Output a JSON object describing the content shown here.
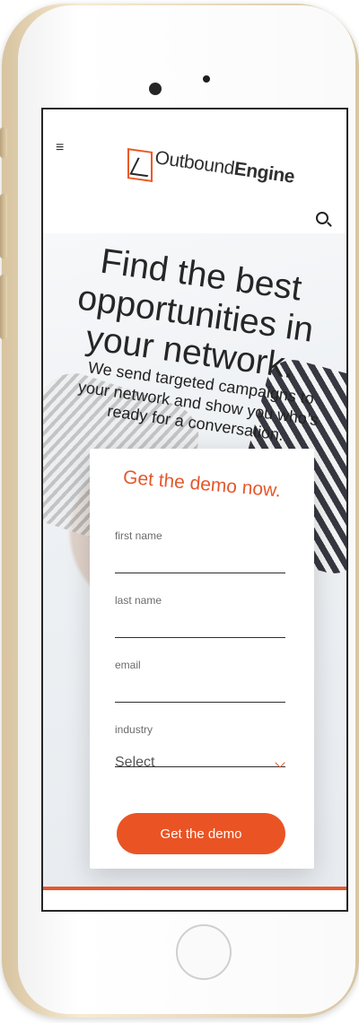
{
  "brand": {
    "light": "Outbound",
    "bold": "Engine"
  },
  "icons": {
    "menu": "menu-icon",
    "search": "search-icon",
    "chevron": "chevron-down-icon",
    "logo": "logo-mark-icon"
  },
  "hero": {
    "headline": "Find the best opportunities in your network.",
    "subhead": "We send targeted campaigns to your network and show you who’s ready for a conversation."
  },
  "form": {
    "title": "Get the demo now.",
    "fields": {
      "first_name": "first name",
      "last_name": "last name",
      "email": "email",
      "industry": "industry",
      "industry_value": "Select"
    },
    "submit": "Get the demo"
  },
  "colors": {
    "accent": "#EA5425",
    "text": "#262626"
  }
}
